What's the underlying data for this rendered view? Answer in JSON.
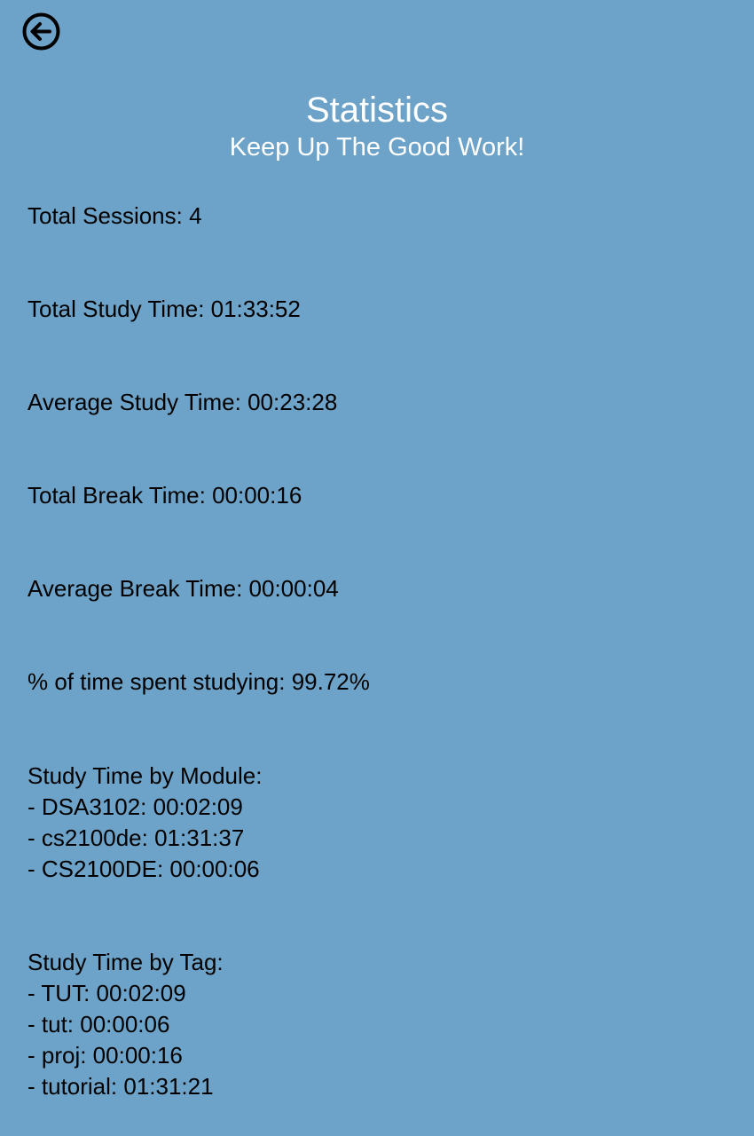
{
  "header": {
    "title": "Statistics",
    "subtitle": "Keep Up The Good Work!"
  },
  "stats": {
    "total_sessions": "Total Sessions: 4",
    "total_study_time": "Total Study Time: 01:33:52",
    "average_study_time": "Average Study Time: 00:23:28",
    "total_break_time": "Total Break Time: 00:00:16",
    "average_break_time": "Average Break Time: 00:00:04",
    "percent_studying": "% of time spent studying: 99.72%"
  },
  "by_module": {
    "heading": "Study Time by Module:",
    "items": [
      "- DSA3102: 00:02:09",
      "- cs2100de: 01:31:37",
      "- CS2100DE: 00:00:06"
    ]
  },
  "by_tag": {
    "heading": "Study Time by Tag:",
    "items": [
      "- TUT: 00:02:09",
      "- tut: 00:00:06",
      "- proj: 00:00:16",
      "- tutorial: 01:31:21"
    ]
  },
  "icons": {
    "back": "arrow-left-circle-icon"
  },
  "colors": {
    "background": "#6da3c8",
    "header_text": "#ffffff",
    "body_text": "#000000"
  }
}
